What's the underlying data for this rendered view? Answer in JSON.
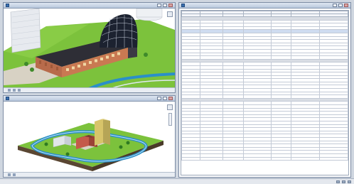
{
  "colors": {
    "window_frame": "#7d8ca4",
    "titlebar": "#c9d5e6",
    "building_wall": "#b86b4b",
    "roof": "#2e2e36",
    "dome": "#1c2230",
    "lawn": "#7cc23c",
    "water": "#2a8fc9",
    "site_base": "#5a4632",
    "group_row": "#d9dde4"
  },
  "windows": {
    "top_view": {
      "title": "",
      "scale": ""
    },
    "bottom_view": {
      "title": "",
      "scale": ""
    },
    "schedule": {
      "title": ""
    }
  },
  "schedule": {
    "columns": [],
    "groups": []
  },
  "taskbar": {
    "status": ""
  },
  "icons": {
    "app": "revit-app-icon",
    "nav": "view-cube-icon",
    "minimize": "minimize-icon",
    "maximize": "maximize-icon",
    "close": "close-icon"
  }
}
